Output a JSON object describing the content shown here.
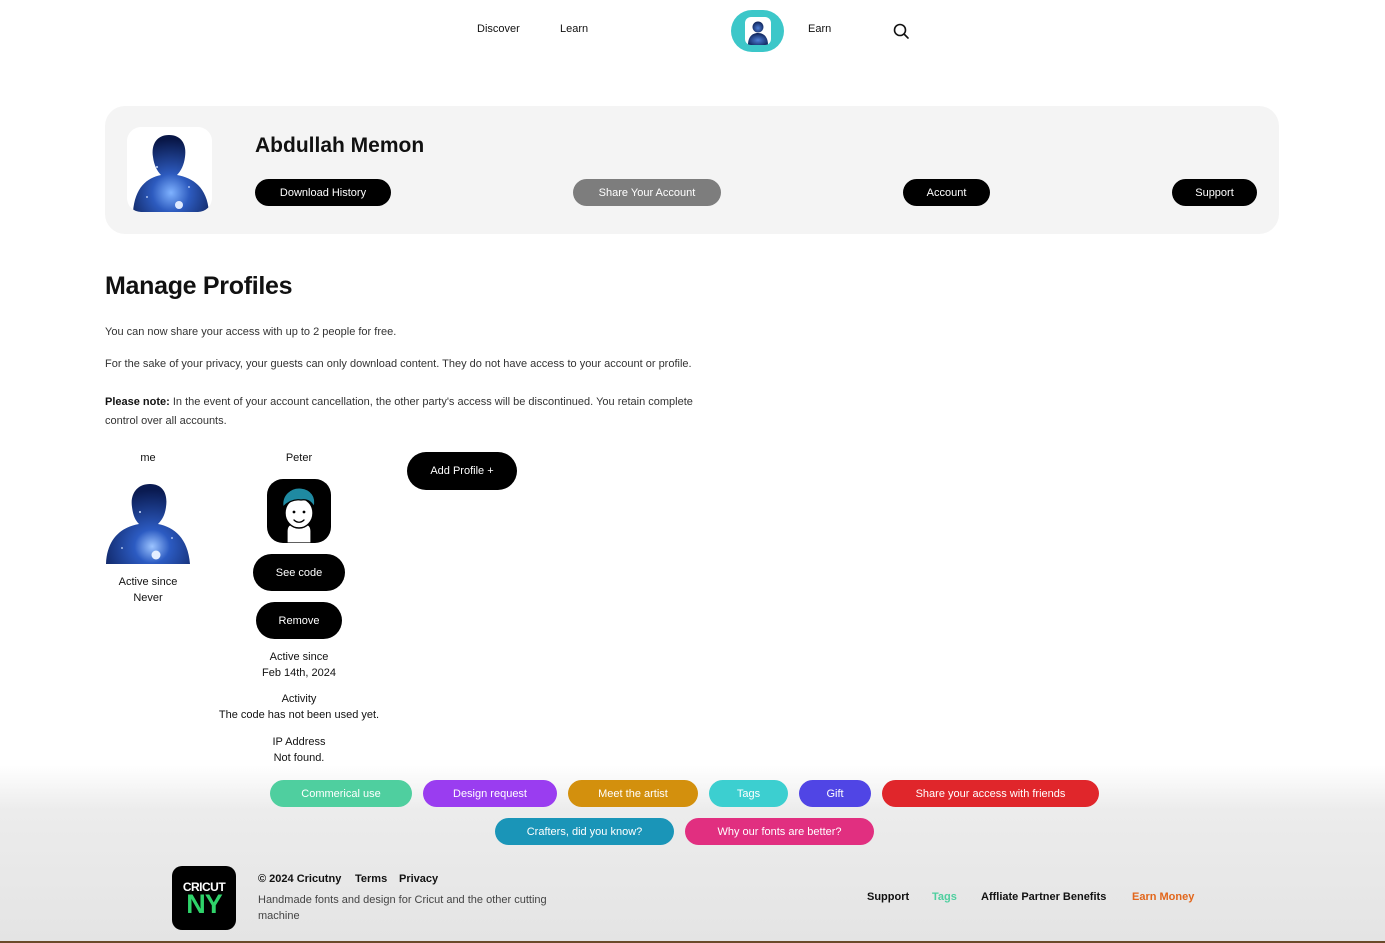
{
  "nav": {
    "links": [
      "Discover",
      "Learn",
      "Earn"
    ],
    "avatar_icon": "user-avatar-icon",
    "search_icon": "search-icon"
  },
  "profile_card": {
    "name": "Abdullah Memon",
    "buttons": [
      "Download History",
      "Share Your Account",
      "Account",
      "Support"
    ]
  },
  "manage": {
    "title": "Manage Profiles",
    "intro": "You can now share your access with up to 2 people for free.",
    "privacy": "For the sake of your privacy, your guests can only download content. They do not have access to your account or profile.",
    "note_label": "Please note:",
    "note_text": "In the event of your account cancellation, the other party's access will be discontinued. You retain complete control over all accounts.",
    "add_profile": "Add Profile +",
    "profiles": [
      {
        "name": "me",
        "active_label": "Active since",
        "active_value": "Never"
      },
      {
        "name": "Peter",
        "see_code": "See code",
        "remove": "Remove",
        "active_label": "Active since",
        "active_value": "Feb 14th, 2024",
        "activity_label": "Activity",
        "activity_value": "The code has not been used yet.",
        "ip_label": "IP Address",
        "ip_value": "Not found."
      }
    ]
  },
  "footer": {
    "tags": [
      {
        "label": "Commerical use",
        "color": "#4fcf9f"
      },
      {
        "label": "Design request",
        "color": "#9a3df0"
      },
      {
        "label": "Meet the artist",
        "color": "#d3900d"
      },
      {
        "label": "Tags",
        "color": "#3ccfd0"
      },
      {
        "label": "Gift",
        "color": "#5045e5"
      },
      {
        "label": "Share your access with friends",
        "color": "#e0262b"
      },
      {
        "label": "Crafters, did you know?",
        "color": "#1a95b8"
      },
      {
        "label": "Why our fonts are better?",
        "color": "#e12f80"
      }
    ],
    "logo_line1": "CRICUT",
    "logo_line2": "NY",
    "copyright": "© 2024 Cricutny",
    "terms": "Terms",
    "privacy": "Privacy",
    "description": "Handmade fonts and design for Cricut and the other cutting machine",
    "links": [
      {
        "label": "Support",
        "color": "#111111"
      },
      {
        "label": "Tags",
        "color": "#4fcf9f"
      },
      {
        "label": "Affliate Partner Benefits",
        "color": "#111111"
      },
      {
        "label": "Earn Money",
        "color": "#e2661b"
      }
    ]
  }
}
